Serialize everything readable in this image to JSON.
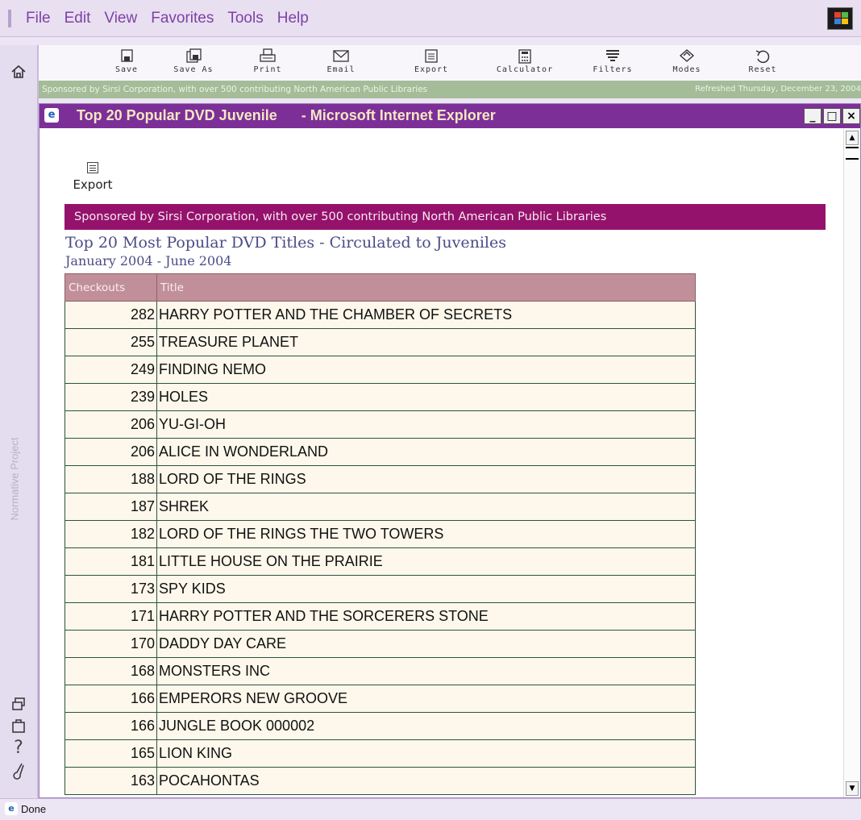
{
  "menu": [
    "File",
    "Edit",
    "View",
    "Favorites",
    "Tools",
    "Help"
  ],
  "toolbar": [
    {
      "label": "Save",
      "icon": "save-icon"
    },
    {
      "label": "Save As",
      "icon": "save-as-icon"
    },
    {
      "label": "Print",
      "icon": "print-icon"
    },
    {
      "label": "Email",
      "icon": "email-icon"
    },
    {
      "label": "Export",
      "icon": "export-icon"
    },
    {
      "label": "Calculator",
      "icon": "calculator-icon"
    },
    {
      "label": "Filters",
      "icon": "filters-icon"
    },
    {
      "label": "Modes",
      "icon": "modes-icon"
    },
    {
      "label": "Reset",
      "icon": "reset-icon"
    }
  ],
  "sponsor_strip": {
    "left": "Sponsored by Sirsi Corporation, with over 500 contributing North American Public Libraries",
    "right": "Refreshed Thursday, December 23, 2004"
  },
  "left_rail": {
    "text": "Normative Project",
    "icons": [
      "home-icon",
      "restore-window-icon",
      "window-icon",
      "help-icon",
      "tool-icon"
    ]
  },
  "ie_window": {
    "title": "Top 20 Popular DVD Juvenile      - Microsoft Internet Explorer",
    "min_label": "_",
    "max_label": "□",
    "close_label": "×"
  },
  "content": {
    "export_label": "Export",
    "banner": "Sponsored by Sirsi Corporation, with over 500 contributing North American Public Libraries",
    "report_title": "Top 20 Most Popular DVD Titles - Circulated to Juveniles",
    "report_subtitle": "January 2004 - June 2004"
  },
  "table": {
    "columns": [
      "Checkouts",
      "Title"
    ],
    "rows": [
      {
        "checkouts": "282",
        "title": "HARRY POTTER AND THE CHAMBER OF SECRETS"
      },
      {
        "checkouts": "255",
        "title": "TREASURE PLANET"
      },
      {
        "checkouts": "249",
        "title": "FINDING NEMO"
      },
      {
        "checkouts": "239",
        "title": "HOLES"
      },
      {
        "checkouts": "206",
        "title": "YU-GI-OH"
      },
      {
        "checkouts": "206",
        "title": "ALICE IN WONDERLAND"
      },
      {
        "checkouts": "188",
        "title": "LORD OF THE RINGS"
      },
      {
        "checkouts": "187",
        "title": "SHREK"
      },
      {
        "checkouts": "182",
        "title": "LORD OF THE RINGS THE TWO TOWERS"
      },
      {
        "checkouts": "181",
        "title": "LITTLE HOUSE ON THE PRAIRIE"
      },
      {
        "checkouts": "173",
        "title": "SPY KIDS"
      },
      {
        "checkouts": "171",
        "title": "HARRY POTTER AND THE SORCERERS STONE"
      },
      {
        "checkouts": "170",
        "title": "DADDY DAY CARE"
      },
      {
        "checkouts": "168",
        "title": "MONSTERS INC"
      },
      {
        "checkouts": "166",
        "title": "EMPERORS NEW GROOVE"
      },
      {
        "checkouts": "166",
        "title": "JUNGLE BOOK 000002"
      },
      {
        "checkouts": "165",
        "title": "LION KING"
      },
      {
        "checkouts": "163",
        "title": "POCAHONTAS"
      }
    ]
  },
  "status": {
    "text": "Done"
  }
}
